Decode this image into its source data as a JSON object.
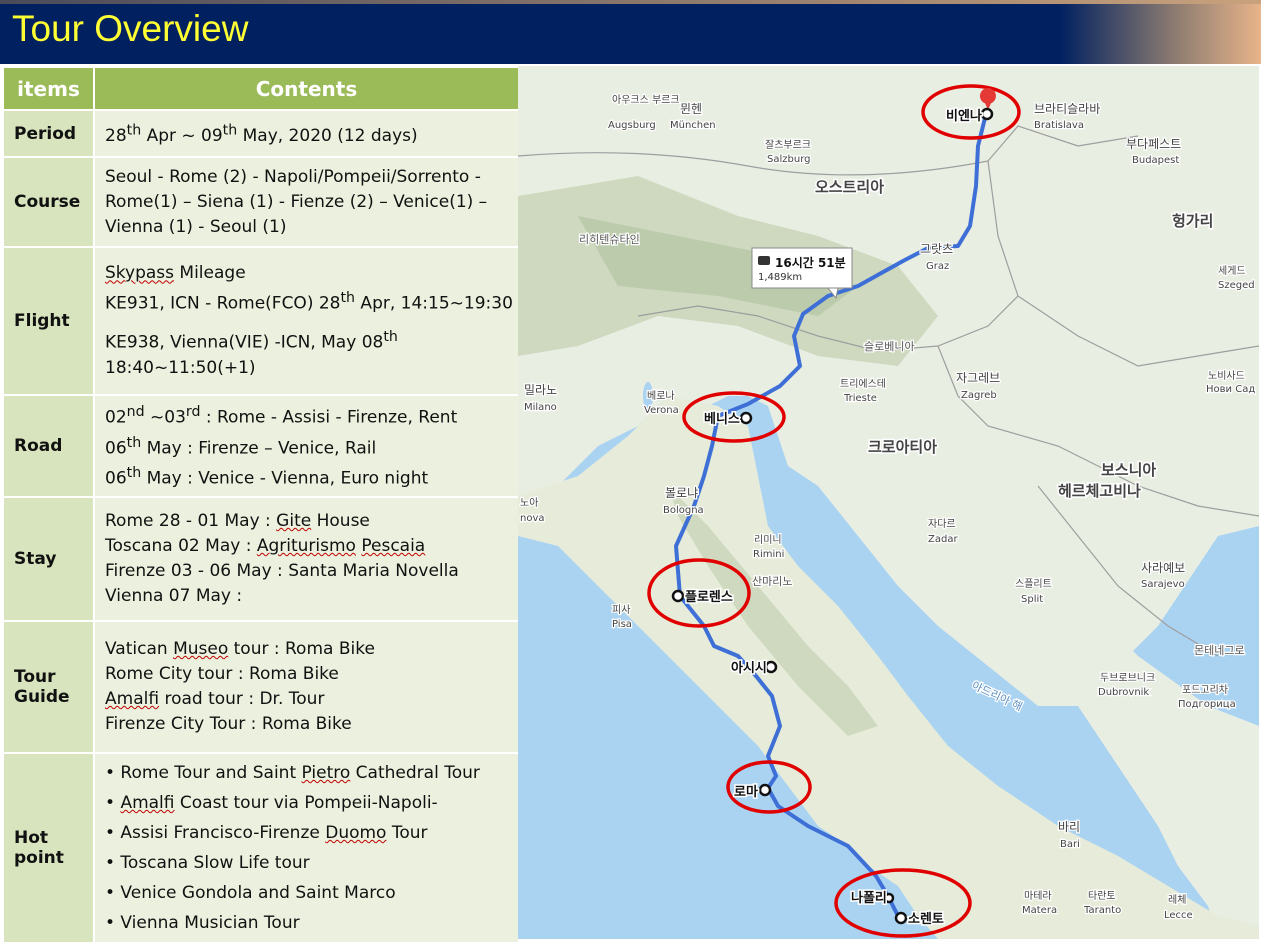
{
  "title": "Tour Overview",
  "table": {
    "header_items": "items",
    "header_contents": "Contents",
    "period": {
      "label": "Period",
      "day1": "28",
      "sup1": "th",
      "mid": " Apr ~ 09",
      "sup2": "th",
      "rest": " May, 2020 (12 days)"
    },
    "course": {
      "label": "Course",
      "l1": "Seoul - Rome (2) - Napoli/Pompeii/Sorrento -",
      "l2": "Rome(1) – Siena (1) - Fienze (2) – Venice(1) –",
      "l3": "Vienna (1) - Seoul (1)"
    },
    "flight": {
      "label": "Flight",
      "l1a": "Skypass",
      "l1b": " Mileage",
      "l2a": "KE931, ICN - Rome(FCO) 28",
      "l2sup": "th",
      "l2b": " Apr, 14:15~19:30",
      "l3a": "KE938, Vienna(VIE) -ICN, May 08",
      "l3sup": "th",
      "l4": "18:40~11:50(+1)"
    },
    "road": {
      "label": "Road",
      "l1a": "02",
      "l1s1": "nd",
      "l1b": " ~03",
      "l1s2": "rd",
      "l1c": " : Rome - Assisi - Firenze, Rent",
      "l2a": "06",
      "l2s": "th",
      "l2b": " May   : Firenze – Venice, Rail",
      "l3a": "06",
      "l3s": "th",
      "l3b": " May   : Venice - Vienna,  Euro night"
    },
    "stay": {
      "label": "Stay",
      "l1a": "Rome     28 - 01 May : ",
      "l1b": "Gite",
      "l1c": " House",
      "l2a": "Toscana 02 May        : ",
      "l2b": "Agriturismo",
      "l2c": " ",
      "l2d": "Pescaia",
      "l3": "Firenze   03 - 06 May : Santa Maria Novella",
      "l4": "Vienna    07 May         :"
    },
    "guide": {
      "label1": "Tour",
      "label2": "Guide",
      "l1a": "Vatican ",
      "l1b": "Museo",
      "l1c": " tour : Roma Bike",
      "l2": "Rome City tour          : Roma Bike",
      "l3a": "Amalfi",
      "l3b": " road tour       : Dr. Tour",
      "l4": "Firenze City Tour       : Roma Bike"
    },
    "hot": {
      "label1": "Hot",
      "label2": "point",
      "b1a": "• Rome Tour and Saint ",
      "b1b": "Pietro",
      "b1c": " Cathedral Tour",
      "b2a": "• ",
      "b2b": "Amalfi",
      "b2c": " Coast tour via Pompeii-Napoli-",
      "b3a": "• Assisi  Francisco-Firenze ",
      "b3b": "Duomo",
      "b3c": " Tour",
      "b4": "• Toscana Slow Life tour",
      "b5": "• Venice Gondola and Saint Marco",
      "b6": "• Vienna Musician Tour"
    }
  },
  "map": {
    "route_time": "16시간 51분",
    "route_distance": "1,489km",
    "stops": [
      "비엔나",
      "베니스",
      "플로렌스",
      "아시시",
      "로마",
      "나폴리",
      "소렌토"
    ],
    "cities": {
      "bratislava_ko": "브라티슬라바",
      "bratislava": "Bratislava",
      "budapest_ko": "부다페스트",
      "budapest": "Budapest",
      "augsburg_ko": "아우크스\n부르크",
      "augsburg": "Augsburg",
      "munich_ko": "뮌헨",
      "munich": "München",
      "salzburg_ko": "잘츠부르크",
      "salzburg": "Salzburg",
      "austria": "오스트리아",
      "hungary": "헝가리",
      "liechtenstein": "리히텐슈타인",
      "graz_ko": "그랏츠",
      "graz": "Graz",
      "szeged_ko": "세게드",
      "szeged": "Szeged",
      "slovenia": "슬로베니아",
      "zagreb_ko": "자그레브",
      "zagreb": "Zagreb",
      "novisad_ko": "노비사드",
      "novisad": "Нови Сад",
      "milano_ko": "밀라노",
      "milano": "Milano",
      "verona_ko": "베로나",
      "verona": "Verona",
      "trieste_ko": "트리에스테",
      "trieste": "Trieste",
      "croatia": "크로아티아",
      "bosnia1": "보스니아",
      "bosnia2": "헤르체고비나",
      "bologna_ko": "볼로냐",
      "bologna": "Bologna",
      "zadar_ko": "자다르",
      "zadar": "Zadar",
      "rimini_ko": "리미니",
      "rimini": "Rimini",
      "sanmarino": "산마리노",
      "pisa_ko": "피사",
      "pisa": "Pisa",
      "split_ko": "스플리트",
      "split": "Split",
      "sarajevo_ko": "사라예보",
      "sarajevo": "Sarajevo",
      "montenegro": "몬테네그로",
      "adriatic": "아드리아 해",
      "dubrovnik_ko": "두브로브니크",
      "dubrovnik": "Dubrovnik",
      "podgorica_ko": "포드고리차",
      "podgorica": "Подгорица",
      "bari_ko": "바리",
      "bari": "Bari",
      "matera_ko": "마테라",
      "matera": "Matera",
      "taranto_ko": "타란토",
      "taranto": "Taranto",
      "lecce_ko": "레체",
      "lecce": "Lecce",
      "nova_ko": "노아",
      "nova": "nova"
    },
    "colors": {
      "route": "#3d6fd6",
      "circle": "#e00000",
      "pin": "#e53935"
    }
  }
}
